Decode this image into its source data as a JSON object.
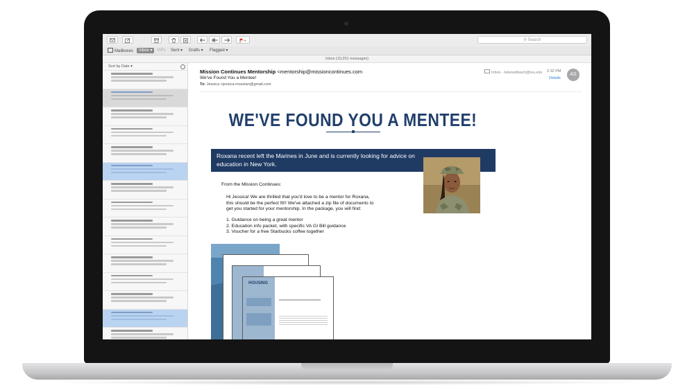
{
  "toolbar": {
    "search_placeholder": "Search"
  },
  "favorites": {
    "mailboxes": "Mailboxes",
    "inbox": "Inbox",
    "vips": "VIPs",
    "sent": "Sent",
    "drafts": "Drafts",
    "flagged": "Flagged"
  },
  "status": "Inbox (10,251 messages)",
  "list": {
    "sort": "Sort by Date"
  },
  "message": {
    "from_name": "Mission Continues Mentorship",
    "from_email": "<mentorship@missioncontinues.com",
    "subject": "We've Found You a Mentee!",
    "to_label": "To:",
    "to": "Jessica <jessica.mosstan@gmail.com",
    "mailbox": "Inbox - lelwoodleach@isu.edu",
    "time": "2:32 PM",
    "details": "Details",
    "avatar": "AS"
  },
  "email": {
    "headline": "WE'VE FOUND YOU A MENTEE!",
    "banner": "Roxana recent left the Marines in June and is currently looking for advice on education in New York.",
    "intro": "From the Mission Continues:",
    "para1": "Hi Jessica! We are thrilled that you'd love to be a mentor for Roxana,",
    "para2": "this should be the perfect fit!! We've attached a zip file of documents to",
    "para3": "get you started for your mentorship. In the package, you will find:",
    "items": [
      "1. Guidance on being a great mentor",
      "2. Education info packet, with specific VA GI Bill guidance",
      "3. Voucher for a free Starbucks coffee together"
    ],
    "doc_title": "HOUSING"
  }
}
